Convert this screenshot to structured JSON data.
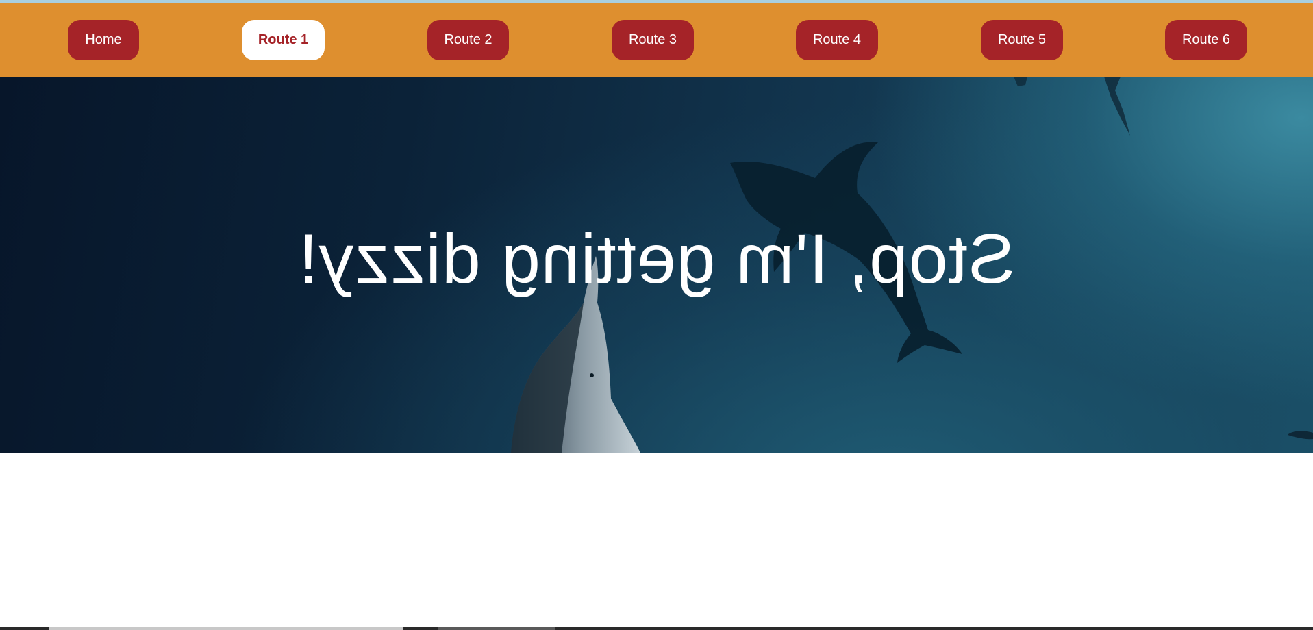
{
  "nav": {
    "items": [
      {
        "label": "Home",
        "active": false
      },
      {
        "label": "Route 1",
        "active": true
      },
      {
        "label": "Route 2",
        "active": false
      },
      {
        "label": "Route 3",
        "active": false
      },
      {
        "label": "Route 4",
        "active": false
      },
      {
        "label": "Route 5",
        "active": false
      },
      {
        "label": "Route 6",
        "active": false
      }
    ]
  },
  "hero": {
    "title": "Stop, I'm getting dizzy!",
    "mirrored": true,
    "background": "underwater-dolphins"
  },
  "colors": {
    "navbar": "#de8f2f",
    "button": "#a52328",
    "button_active_bg": "#ffffff",
    "button_text": "#ffffff"
  }
}
